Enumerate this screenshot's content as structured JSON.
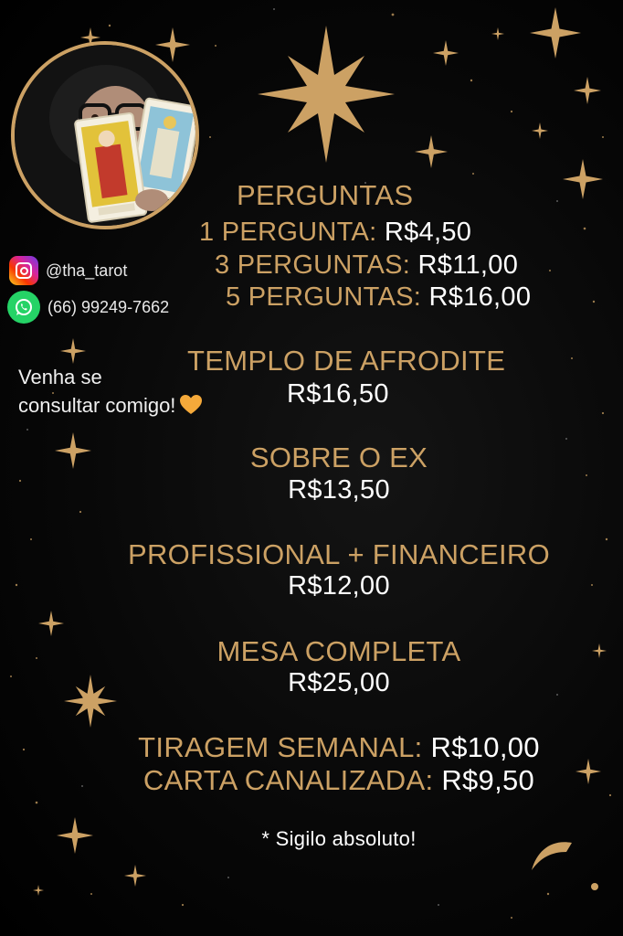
{
  "social": {
    "instagram": "@tha_tarot",
    "whatsapp": "(66) 99249-7662"
  },
  "invite": {
    "line1": "Venha se",
    "line2": "consultar comigo!"
  },
  "perguntas": {
    "title": "PERGUNTAS",
    "items": [
      {
        "label": "1 PERGUNTA:",
        "price": "R$4,50"
      },
      {
        "label": "3 PERGUNTAS:",
        "price": "R$11,00"
      },
      {
        "label": "5 PERGUNTAS:",
        "price": "R$16,00"
      }
    ]
  },
  "services": [
    {
      "name": "TEMPLO DE AFRODITE",
      "price": "R$16,50"
    },
    {
      "name": "SOBRE O EX",
      "price": "R$13,50"
    },
    {
      "name": "PROFISSIONAL + FINANCEIRO",
      "price": "R$12,00"
    },
    {
      "name": "MESA COMPLETA",
      "price": "R$25,00"
    }
  ],
  "extras": [
    {
      "label": "TIRAGEM SEMANAL:",
      "price": "R$10,00"
    },
    {
      "label": "CARTA CANALIZADA:",
      "price": "R$9,50"
    }
  ],
  "footnote": "* Sigilo absoluto!",
  "colors": {
    "gold": "#cca164",
    "background": "#000000",
    "text": "#ffffff"
  },
  "icons": [
    "instagram-icon",
    "whatsapp-icon",
    "heart-icon",
    "star-icon",
    "crescent-moon-icon"
  ]
}
